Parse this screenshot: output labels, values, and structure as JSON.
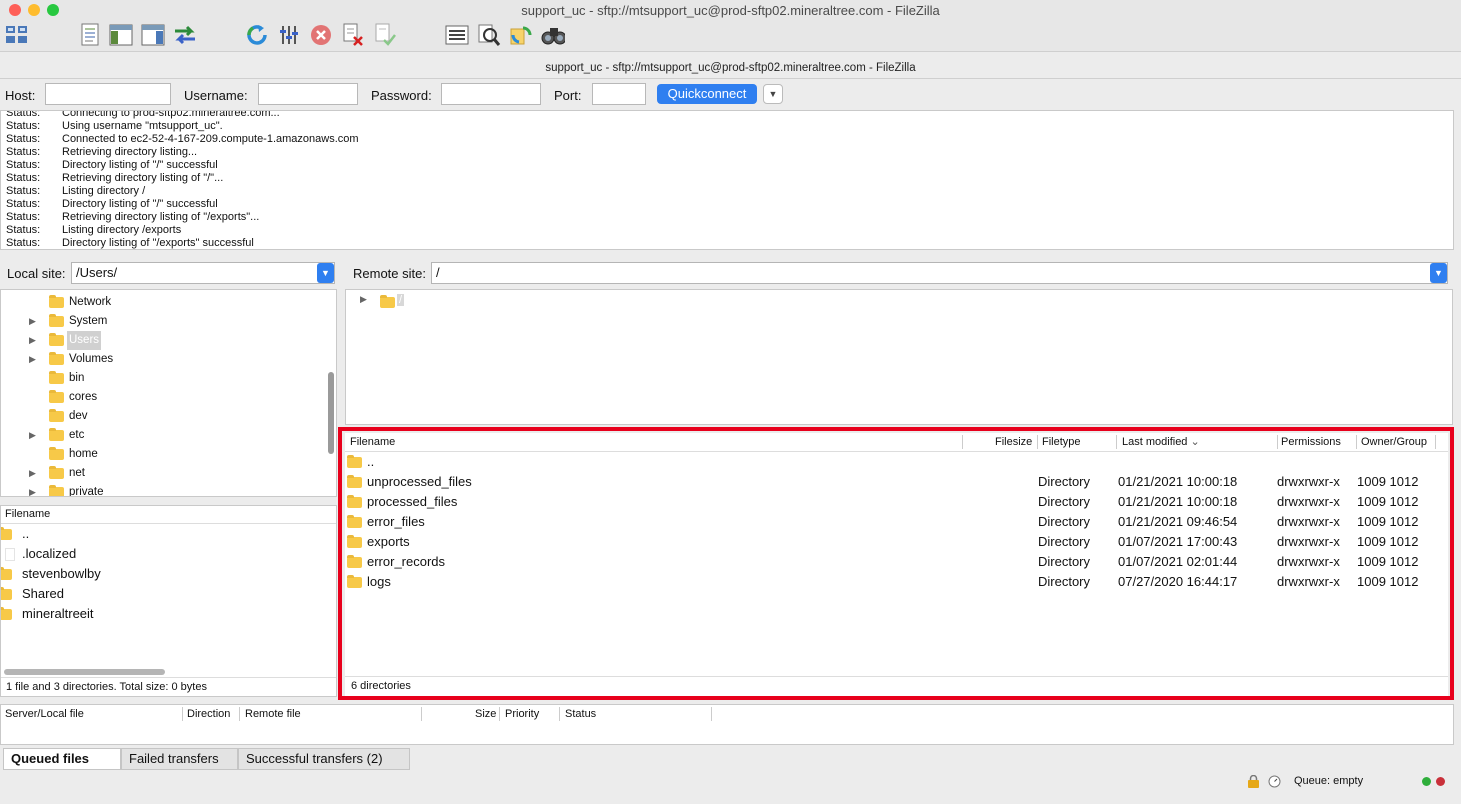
{
  "window": {
    "title": "support_uc - sftp://mtsupport_uc@prod-sftp02.mineraltree.com - FileZilla"
  },
  "toolbar": {
    "icons": [
      "site-manager-icon",
      "message-log-icon",
      "local-tree-icon",
      "remote-tree-icon",
      "transfer-queue-icon",
      "refresh-icon",
      "process-queue-icon",
      "cancel-icon",
      "disconnect-icon",
      "reconnect-icon",
      "directory-filter-icon",
      "compare-icon",
      "sync-browse-icon",
      "search-icon"
    ]
  },
  "subtitle": "support_uc - sftp://mtsupport_uc@prod-sftp02.mineraltree.com - FileZilla",
  "quickconnect": {
    "host_label": "Host:",
    "host_value": "",
    "username_label": "Username:",
    "username_value": "",
    "password_label": "Password:",
    "password_value": "",
    "port_label": "Port:",
    "port_value": "",
    "button_label": "Quickconnect"
  },
  "log": [
    {
      "status": "Status:",
      "msg": "Connecting to prod-sftp02.mineraltree.com..."
    },
    {
      "status": "Status:",
      "msg": "Using username \"mtsupport_uc\"."
    },
    {
      "status": "Status:",
      "msg": "Connected to ec2-52-4-167-209.compute-1.amazonaws.com"
    },
    {
      "status": "Status:",
      "msg": "Retrieving directory listing..."
    },
    {
      "status": "Status:",
      "msg": "Directory listing of \"/\" successful"
    },
    {
      "status": "Status:",
      "msg": "Retrieving directory listing of \"/\"..."
    },
    {
      "status": "Status:",
      "msg": "Listing directory /"
    },
    {
      "status": "Status:",
      "msg": "Directory listing of \"/\" successful"
    },
    {
      "status": "Status:",
      "msg": "Retrieving directory listing of \"/exports\"..."
    },
    {
      "status": "Status:",
      "msg": "Listing directory /exports"
    },
    {
      "status": "Status:",
      "msg": "Directory listing of \"/exports\" successful"
    }
  ],
  "local": {
    "site_label": "Local site:",
    "site_value": "/Users/",
    "tree": [
      {
        "name": "Network",
        "expandable": false
      },
      {
        "name": "System",
        "expandable": true
      },
      {
        "name": "Users",
        "expandable": true,
        "selected": true
      },
      {
        "name": "Volumes",
        "expandable": true
      },
      {
        "name": "bin",
        "expandable": false
      },
      {
        "name": "cores",
        "expandable": false
      },
      {
        "name": "dev",
        "expandable": false
      },
      {
        "name": "etc",
        "expandable": true
      },
      {
        "name": "home",
        "expandable": false
      },
      {
        "name": "net",
        "expandable": true
      },
      {
        "name": "private",
        "expandable": true
      }
    ],
    "filename_header": "Filename",
    "files": [
      {
        "name": "..",
        "type": "folder"
      },
      {
        "name": ".localized",
        "type": "file"
      },
      {
        "name": "stevenbowlby",
        "type": "folder"
      },
      {
        "name": "Shared",
        "type": "folder"
      },
      {
        "name": "mineraltreeit",
        "type": "folder"
      }
    ],
    "status": "1 file and 3 directories. Total size: 0 bytes"
  },
  "remote": {
    "site_label": "Remote site:",
    "site_value": "/",
    "tree_root": "/",
    "headers": {
      "filename": "Filename",
      "filesize": "Filesize",
      "filetype": "Filetype",
      "modified": "Last modified",
      "permissions": "Permissions",
      "owner": "Owner/Group"
    },
    "files": [
      {
        "name": "..",
        "type": "",
        "modified": "",
        "perm": "",
        "owner": ""
      },
      {
        "name": "unprocessed_files",
        "type": "Directory",
        "modified": "01/21/2021 10:00:18",
        "perm": "drwxrwxr-x",
        "owner": "1009 1012"
      },
      {
        "name": "processed_files",
        "type": "Directory",
        "modified": "01/21/2021 10:00:18",
        "perm": "drwxrwxr-x",
        "owner": "1009 1012"
      },
      {
        "name": "error_files",
        "type": "Directory",
        "modified": "01/21/2021 09:46:54",
        "perm": "drwxrwxr-x",
        "owner": "1009 1012"
      },
      {
        "name": "exports",
        "type": "Directory",
        "modified": "01/07/2021 17:00:43",
        "perm": "drwxrwxr-x",
        "owner": "1009 1012"
      },
      {
        "name": "error_records",
        "type": "Directory",
        "modified": "01/07/2021 02:01:44",
        "perm": "drwxrwxr-x",
        "owner": "1009 1012"
      },
      {
        "name": "logs",
        "type": "Directory",
        "modified": "07/27/2020 16:44:17",
        "perm": "drwxrwxr-x",
        "owner": "1009 1012"
      }
    ],
    "status": "6 directories",
    "highlight_color": "#e8001c"
  },
  "queue": {
    "headers": {
      "server": "Server/Local file",
      "direction": "Direction",
      "remote": "Remote file",
      "size": "Size",
      "priority": "Priority",
      "status": "Status"
    },
    "tabs": [
      "Queued files",
      "Failed transfers",
      "Successful transfers (2)"
    ],
    "status": "Queue: empty"
  }
}
